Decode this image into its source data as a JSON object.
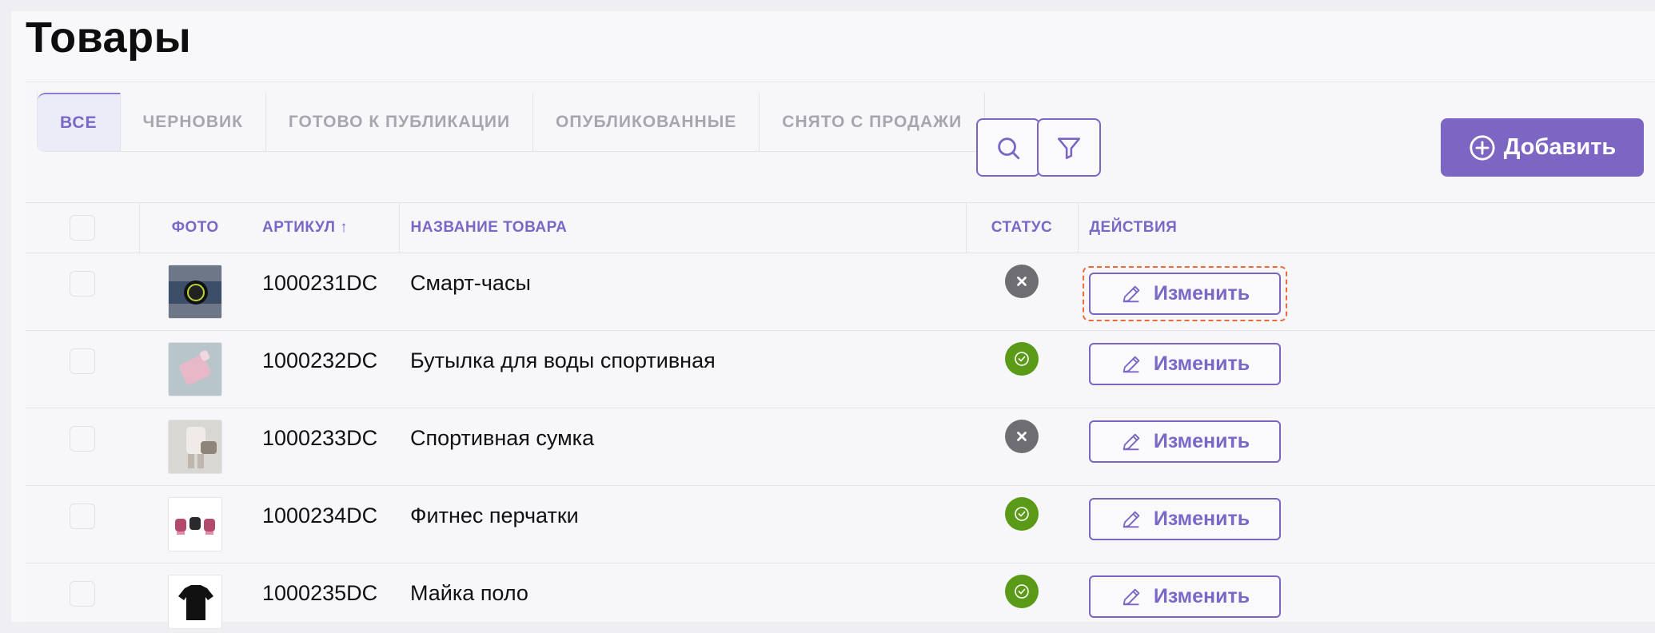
{
  "page": {
    "title": "Товары"
  },
  "tabs": [
    {
      "label": "ВСЕ"
    },
    {
      "label": "ЧЕРНОВИК"
    },
    {
      "label": "ГОТОВО К ПУБЛИКАЦИИ"
    },
    {
      "label": "ОПУБЛИКОВАННЫЕ"
    },
    {
      "label": "СНЯТО С ПРОДАЖИ"
    }
  ],
  "toolbar": {
    "search_icon": "search-icon",
    "filter_icon": "filter-icon",
    "add_label": "Добавить"
  },
  "table": {
    "columns": {
      "photo": "ФОТО",
      "sku": "АРТИКУЛ ↑",
      "name": "НАЗВАНИЕ ТОВАРА",
      "status": "СТАТУС",
      "actions": "ДЕЙСТВИЯ"
    },
    "edit_label": "Изменить",
    "rows": [
      {
        "sku": "1000231DC",
        "name": "Смарт-часы",
        "status": "inactive"
      },
      {
        "sku": "1000232DC",
        "name": "Бутылка для воды спортивная",
        "status": "active"
      },
      {
        "sku": "1000233DC",
        "name": "Спортивная сумка",
        "status": "inactive"
      },
      {
        "sku": "1000234DC",
        "name": "Фитнес перчатки",
        "status": "active"
      },
      {
        "sku": "1000235DC",
        "name": "Майка поло",
        "status": "active"
      }
    ]
  },
  "colors": {
    "accent": "#7d65c3",
    "status_active": "#5b9a17",
    "status_inactive": "#6e6e72",
    "focus_outline": "#ea6a3a"
  }
}
